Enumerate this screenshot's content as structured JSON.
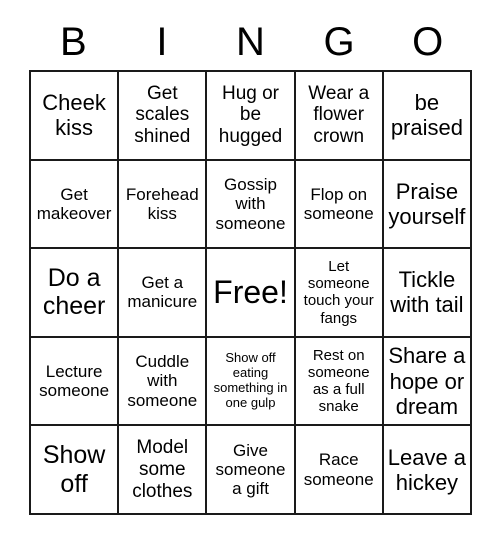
{
  "card": {
    "title_letters": [
      "B",
      "I",
      "N",
      "G",
      "O"
    ],
    "colors": {
      "background": "#ffffff",
      "grid_line": "#1a1a1a",
      "text": "#000000"
    },
    "rows": [
      [
        {
          "text": "Cheek kiss",
          "size": "xl"
        },
        {
          "text": "Get scales shined",
          "size": "l"
        },
        {
          "text": "Hug or be hugged",
          "size": "l"
        },
        {
          "text": "Wear a flower crown",
          "size": "l"
        },
        {
          "text": "be praised",
          "size": "xl"
        }
      ],
      [
        {
          "text": "Get makeover",
          "size": "m"
        },
        {
          "text": "Forehead kiss",
          "size": "m"
        },
        {
          "text": "Gossip with someone",
          "size": "m"
        },
        {
          "text": "Flop on someone",
          "size": "m"
        },
        {
          "text": "Praise yourself",
          "size": "xl"
        }
      ],
      [
        {
          "text": "Do a cheer",
          "size": "xxl"
        },
        {
          "text": "Get a manicure",
          "size": "m"
        },
        {
          "text": "Free!",
          "size": "free"
        },
        {
          "text": "Let someone touch your fangs",
          "size": "s"
        },
        {
          "text": "Tickle with tail",
          "size": "xl"
        }
      ],
      [
        {
          "text": "Lecture someone",
          "size": "m"
        },
        {
          "text": "Cuddle with someone",
          "size": "m"
        },
        {
          "text": "Show off eating something in one gulp",
          "size": "xs"
        },
        {
          "text": "Rest on someone as a full snake",
          "size": "s"
        },
        {
          "text": "Share a hope or dream",
          "size": "xl"
        }
      ],
      [
        {
          "text": "Show off",
          "size": "xxl"
        },
        {
          "text": "Model some clothes",
          "size": "l"
        },
        {
          "text": "Give someone a gift",
          "size": "m"
        },
        {
          "text": "Race someone",
          "size": "m"
        },
        {
          "text": "Leave a hickey",
          "size": "xl"
        }
      ]
    ]
  }
}
